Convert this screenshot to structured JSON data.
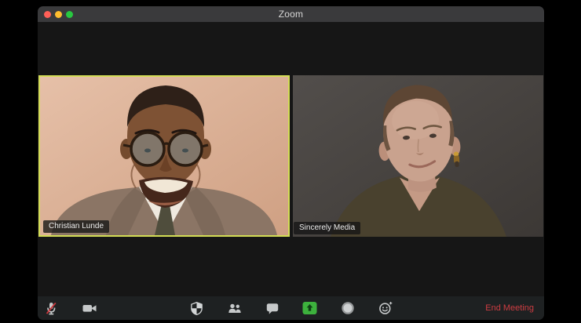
{
  "window": {
    "title": "Zoom"
  },
  "titlebar": {
    "buttons": [
      "close",
      "minimize",
      "fullscreen"
    ]
  },
  "participants": [
    {
      "name": "Christian Lunde",
      "active_speaker": true
    },
    {
      "name": "Sincerely Media",
      "active_speaker": false
    }
  ],
  "toolbar": {
    "buttons": [
      {
        "id": "mute",
        "icon": "microphone-muted-icon",
        "state": "muted"
      },
      {
        "id": "video",
        "icon": "video-camera-icon"
      },
      {
        "id": "security",
        "icon": "shield-icon"
      },
      {
        "id": "participants",
        "icon": "participants-icon"
      },
      {
        "id": "chat",
        "icon": "chat-bubble-icon"
      },
      {
        "id": "share-screen",
        "icon": "share-screen-icon"
      },
      {
        "id": "record",
        "icon": "record-icon"
      },
      {
        "id": "reactions",
        "icon": "reactions-icon"
      }
    ],
    "end_meeting_label": "End Meeting"
  },
  "colors": {
    "active_speaker_border": "#d3dd55",
    "end_meeting_text": "#ce3d42",
    "share_screen_green": "#3db13d",
    "titlebar_bg": "#3a3a3c",
    "window_bg": "#161616",
    "toolbar_bg": "#1e2122",
    "traffic_close": "#ff5f57",
    "traffic_minimize": "#febc2e",
    "traffic_fullscreen": "#28c840"
  }
}
